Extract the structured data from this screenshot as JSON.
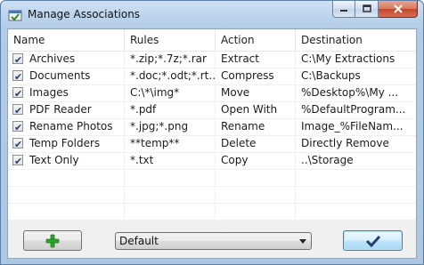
{
  "window": {
    "title": "Manage Associations"
  },
  "columns": [
    "Name",
    "Rules",
    "Action",
    "Destination"
  ],
  "rows": [
    {
      "checked": true,
      "name": "Archives",
      "rules": "*.zip;*.7z;*.rar",
      "action": "Extract",
      "destination": "C:\\My Extractions"
    },
    {
      "checked": true,
      "name": "Documents",
      "rules": "*.doc;*.odt;*.rt...",
      "action": "Compress",
      "destination": "C:\\Backups"
    },
    {
      "checked": true,
      "name": "Images",
      "rules": "C:\\*\\img*",
      "action": "Move",
      "destination": "%Desktop%\\My ..."
    },
    {
      "checked": true,
      "name": "PDF Reader",
      "rules": "*.pdf",
      "action": "Open With",
      "destination": "%DefaultProgram..."
    },
    {
      "checked": true,
      "name": "Rename Photos",
      "rules": "*.jpg;*.png",
      "action": "Rename",
      "destination": "Image_%FileNam..."
    },
    {
      "checked": true,
      "name": "Temp Folders",
      "rules": "**temp**",
      "action": "Delete",
      "destination": "Directly Remove"
    },
    {
      "checked": true,
      "name": "Text Only",
      "rules": "*.txt",
      "action": "Copy",
      "destination": "..\\Storage"
    }
  ],
  "footer": {
    "profile_selected": "Default",
    "add_icon": "plus-icon",
    "ok_icon": "checkmark-icon"
  },
  "colors": {
    "plus": "#2fa52f",
    "check": "#2c3f6a"
  }
}
